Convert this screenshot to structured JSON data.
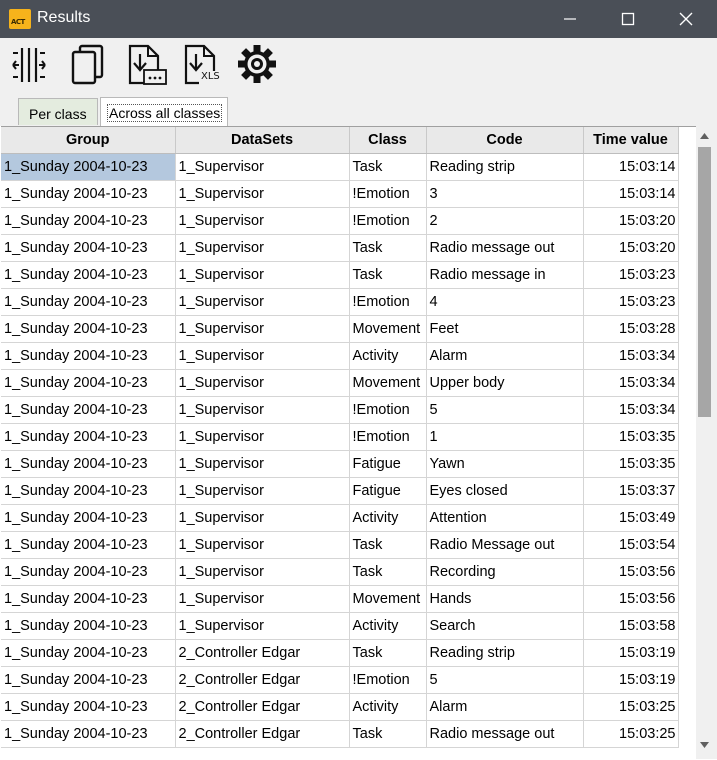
{
  "window": {
    "title": "Results",
    "app_icon_text": "ACT"
  },
  "toolbar": {
    "xls_label": "XLS",
    "icons": [
      "columns-icon",
      "copy-icon",
      "export-icon",
      "export-xls-icon",
      "gear-icon"
    ]
  },
  "tabs": [
    {
      "label": "Per class",
      "active": false
    },
    {
      "label": "Across all classes",
      "active": true
    }
  ],
  "table": {
    "columns": [
      "Group",
      "DataSets",
      "Class",
      "Code",
      "Time value"
    ],
    "rows": [
      [
        "1_Sunday 2004-10-23",
        "1_Supervisor",
        "Task",
        "Reading strip",
        "15:03:14"
      ],
      [
        "1_Sunday 2004-10-23",
        "1_Supervisor",
        "!Emotion",
        "3",
        "15:03:14"
      ],
      [
        "1_Sunday 2004-10-23",
        "1_Supervisor",
        "!Emotion",
        "2",
        "15:03:20"
      ],
      [
        "1_Sunday 2004-10-23",
        "1_Supervisor",
        "Task",
        "Radio message out",
        "15:03:20"
      ],
      [
        "1_Sunday 2004-10-23",
        "1_Supervisor",
        "Task",
        "Radio message in",
        "15:03:23"
      ],
      [
        "1_Sunday 2004-10-23",
        "1_Supervisor",
        "!Emotion",
        "4",
        "15:03:23"
      ],
      [
        "1_Sunday 2004-10-23",
        "1_Supervisor",
        "Movement",
        "Feet",
        "15:03:28"
      ],
      [
        "1_Sunday 2004-10-23",
        "1_Supervisor",
        "Activity",
        "Alarm",
        "15:03:34"
      ],
      [
        "1_Sunday 2004-10-23",
        "1_Supervisor",
        "Movement",
        "Upper body",
        "15:03:34"
      ],
      [
        "1_Sunday 2004-10-23",
        "1_Supervisor",
        "!Emotion",
        "5",
        "15:03:34"
      ],
      [
        "1_Sunday 2004-10-23",
        "1_Supervisor",
        "!Emotion",
        "1",
        "15:03:35"
      ],
      [
        "1_Sunday 2004-10-23",
        "1_Supervisor",
        "Fatigue",
        "Yawn",
        "15:03:35"
      ],
      [
        "1_Sunday 2004-10-23",
        "1_Supervisor",
        "Fatigue",
        "Eyes closed",
        "15:03:37"
      ],
      [
        "1_Sunday 2004-10-23",
        "1_Supervisor",
        "Activity",
        "Attention",
        "15:03:49"
      ],
      [
        "1_Sunday 2004-10-23",
        "1_Supervisor",
        "Task",
        "Radio Message out",
        "15:03:54"
      ],
      [
        "1_Sunday 2004-10-23",
        "1_Supervisor",
        "Task",
        "Recording",
        "15:03:56"
      ],
      [
        "1_Sunday 2004-10-23",
        "1_Supervisor",
        "Movement",
        "Hands",
        "15:03:56"
      ],
      [
        "1_Sunday 2004-10-23",
        "1_Supervisor",
        "Activity",
        "Search",
        "15:03:58"
      ],
      [
        "1_Sunday 2004-10-23",
        "2_Controller Edgar",
        "Task",
        "Reading strip",
        "15:03:19"
      ],
      [
        "1_Sunday 2004-10-23",
        "2_Controller Edgar",
        "!Emotion",
        "5",
        "15:03:19"
      ],
      [
        "1_Sunday 2004-10-23",
        "2_Controller Edgar",
        "Activity",
        "Alarm",
        "15:03:25"
      ],
      [
        "1_Sunday 2004-10-23",
        "2_Controller Edgar",
        "Task",
        "Radio message out",
        "15:03:25"
      ]
    ]
  },
  "colors": {
    "titlebar": "#4a4f57",
    "selection": "#b4c8de",
    "header": "#e9e9e9"
  }
}
